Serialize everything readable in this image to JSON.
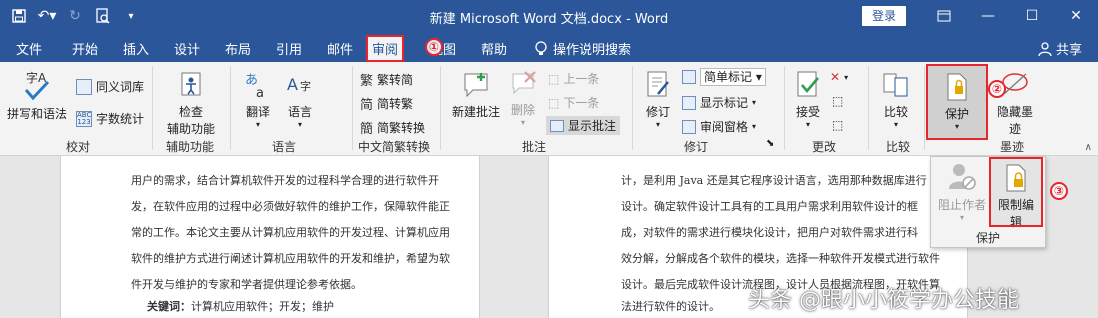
{
  "titlebar": {
    "title": "新建 Microsoft Word 文档.docx  -  Word",
    "login_label": "登录",
    "qat": [
      "save-icon",
      "undo-icon",
      "redo-icon",
      "print-preview-icon",
      "customize-icon"
    ]
  },
  "tabs": [
    {
      "label": "文件"
    },
    {
      "label": "开始"
    },
    {
      "label": "插入"
    },
    {
      "label": "设计"
    },
    {
      "label": "布局"
    },
    {
      "label": "引用"
    },
    {
      "label": "邮件"
    },
    {
      "label": "审阅"
    },
    {
      "label": "视图"
    },
    {
      "label": "帮助"
    }
  ],
  "tell_me": "操作说明搜索",
  "share": "共享",
  "annotations": {
    "one": "①",
    "two": "②",
    "three": "③"
  },
  "ribbon": {
    "proofing": {
      "spelling": "拼写和语法",
      "thesaurus": "同义词库",
      "word_count": "字数统计",
      "label": "校对"
    },
    "accessibility": {
      "check": "检查\n辅助功能",
      "check1": "检查",
      "check2": "辅助功能",
      "label": "辅助功能"
    },
    "language": {
      "translate": "翻译",
      "language": "语言",
      "label": "语言"
    },
    "chinese": {
      "t2s": "繁转简",
      "s2t": "简转繁",
      "convert": "简繁转换",
      "label": "中文简繁转换"
    },
    "comments": {
      "new": "新建批注",
      "delete": "删除",
      "prev": "上一条",
      "next": "下一条",
      "show": "显示批注",
      "label": "批注"
    },
    "tracking": {
      "track": "修订",
      "markup_select": "简单标记",
      "show_markup": "显示标记",
      "pane": "审阅窗格",
      "label": "修订"
    },
    "changes": {
      "accept": "接受",
      "label": "更改"
    },
    "compare": {
      "compare": "比较",
      "label": "比较"
    },
    "protect": {
      "protect": "保护"
    },
    "ink": {
      "hide1": "隐藏墨",
      "hide2": "迹",
      "label": "墨迹"
    }
  },
  "popup": {
    "block_authors": "阻止作者",
    "restrict": "限制编辑",
    "restrict1": "限制编",
    "restrict2": "辑",
    "label": "保护"
  },
  "pages": {
    "left_lines": [
      "用户的需求，结合计算机软件开发的过程科学合理的进行软件开",
      "发，在软件应用的过程中必须做好软件的维护工作，保障软件能正",
      "常的工作。本论文主要从计算机应用软件的开发过程、计算机应用",
      "软件的维护方式进行阐述计算机应用软件的开发和维护，希望为软",
      "件开发与维护的专家和学者提供理论参考依据。"
    ],
    "keywords_label": "关键词：",
    "keywords": "计算机应用软件；开发；维护",
    "right_lines": [
      "计，是利用 Java 还是其它程序设计语言，选用那种数据库进行",
      "设计。确定软件设计工具有的工具用户需求利用软件设计的框",
      "成，对软件的需求进行模块化设计，把用户对软件需求进行科",
      "效分解，分解成各个软件的模块，选择一种软件开发模式进行软件",
      "设计。最后完成软件设计流程图，设计人员根据流程图，开软件算",
      "法进行软件的设计。"
    ]
  },
  "watermark": "头条 @跟小小筱学办公技能",
  "colors": {
    "brand": "#2b579a",
    "highlight": "#e8242d",
    "ribbon_bg": "#f3f3f3"
  }
}
